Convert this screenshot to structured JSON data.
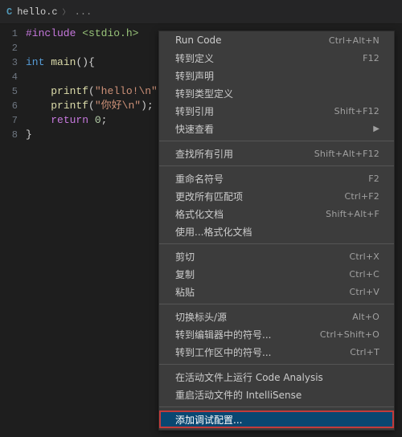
{
  "tab": {
    "icon_letter": "C",
    "filename": "hello.c",
    "breadcrumb_ellipsis": "..."
  },
  "lines": [
    "1",
    "2",
    "3",
    "4",
    "5",
    "6",
    "7",
    "8"
  ],
  "code": {
    "include_kw": "#include",
    "include_hdr": "<stdio.h>",
    "int_kw": "int",
    "main_name": "main",
    "parens": "()",
    "brace_open": "{",
    "call1": "printf",
    "str1": "\"hello!\\n\"",
    "call2": "printf",
    "str2": "\"你好\\n\"",
    "return_kw": "return",
    "zero": "0",
    "semi": ";",
    "brace_close": "}"
  },
  "menu": {
    "groups": [
      [
        {
          "label": "Run Code",
          "shortcut": "Ctrl+Alt+N",
          "sub": false
        },
        {
          "label": "转到定义",
          "shortcut": "F12",
          "sub": false
        },
        {
          "label": "转到声明",
          "shortcut": "",
          "sub": false
        },
        {
          "label": "转到类型定义",
          "shortcut": "",
          "sub": false
        },
        {
          "label": "转到引用",
          "shortcut": "Shift+F12",
          "sub": false
        },
        {
          "label": "快速查看",
          "shortcut": "",
          "sub": true
        }
      ],
      [
        {
          "label": "查找所有引用",
          "shortcut": "Shift+Alt+F12",
          "sub": false
        }
      ],
      [
        {
          "label": "重命名符号",
          "shortcut": "F2",
          "sub": false
        },
        {
          "label": "更改所有匹配项",
          "shortcut": "Ctrl+F2",
          "sub": false
        },
        {
          "label": "格式化文档",
          "shortcut": "Shift+Alt+F",
          "sub": false
        },
        {
          "label": "使用...格式化文档",
          "shortcut": "",
          "sub": false
        }
      ],
      [
        {
          "label": "剪切",
          "shortcut": "Ctrl+X",
          "sub": false
        },
        {
          "label": "复制",
          "shortcut": "Ctrl+C",
          "sub": false
        },
        {
          "label": "粘贴",
          "shortcut": "Ctrl+V",
          "sub": false
        }
      ],
      [
        {
          "label": "切换标头/源",
          "shortcut": "Alt+O",
          "sub": false
        },
        {
          "label": "转到编辑器中的符号...",
          "shortcut": "Ctrl+Shift+O",
          "sub": false
        },
        {
          "label": "转到工作区中的符号...",
          "shortcut": "Ctrl+T",
          "sub": false
        }
      ],
      [
        {
          "label": "在活动文件上运行 Code Analysis",
          "shortcut": "",
          "sub": false
        },
        {
          "label": "重启活动文件的 IntelliSense",
          "shortcut": "",
          "sub": false
        }
      ],
      [
        {
          "label": "添加调试配置...",
          "shortcut": "",
          "sub": false,
          "highlight": true,
          "boxed": true
        }
      ]
    ]
  }
}
